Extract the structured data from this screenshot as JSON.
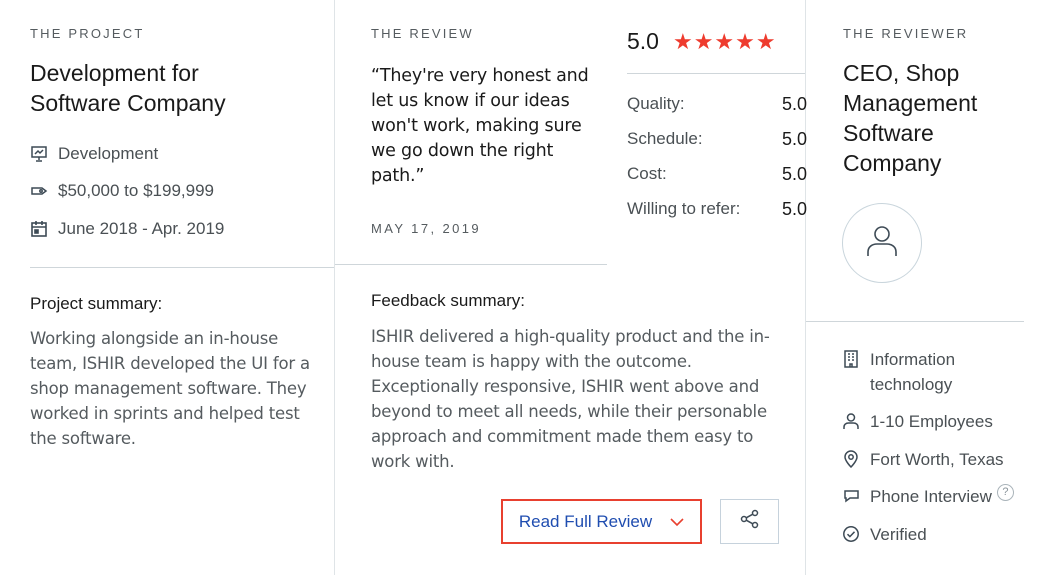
{
  "project": {
    "eyebrow": "THE PROJECT",
    "title": "Development for Software Company",
    "service": "Development",
    "budget": "$50,000 to $199,999",
    "dates": "June 2018 - Apr. 2019",
    "summary_label": "Project summary:",
    "summary_text": "Working alongside an in-house team, ISHIR developed the UI for a shop management software. They worked in sprints and helped test the software."
  },
  "review": {
    "eyebrow": "THE REVIEW",
    "quote": "“They're very honest and let us know if our ideas won't work, making sure we go down the right path.”",
    "date": "MAY 17, 2019",
    "overall": "5.0",
    "stars": "★★★★★",
    "star_rating": 5,
    "scores": [
      {
        "label": "Quality:",
        "value": "5.0"
      },
      {
        "label": "Schedule:",
        "value": "5.0"
      },
      {
        "label": "Cost:",
        "value": "5.0"
      },
      {
        "label": "Willing to refer:",
        "value": "5.0"
      }
    ],
    "feedback_label": "Feedback summary:",
    "feedback_text": "ISHIR delivered a high-quality product and the in-house team is happy with the outcome. Exceptionally responsive, ISHIR went above and beyond to meet all needs, while their personable approach and commitment made them easy to work with.",
    "read_full_label": "Read Full Review"
  },
  "reviewer": {
    "eyebrow": "THE REVIEWER",
    "title": "CEO, Shop Management Software Company",
    "industry": "Information technology",
    "size": "1-10 Employees",
    "location": "Fort Worth, Texas",
    "interview": "Phone Interview",
    "interview_help": "?",
    "verified": "Verified"
  },
  "colors": {
    "accent_red": "#e8402f",
    "link_blue": "#1f4db0",
    "star": "#ee3b2e"
  }
}
